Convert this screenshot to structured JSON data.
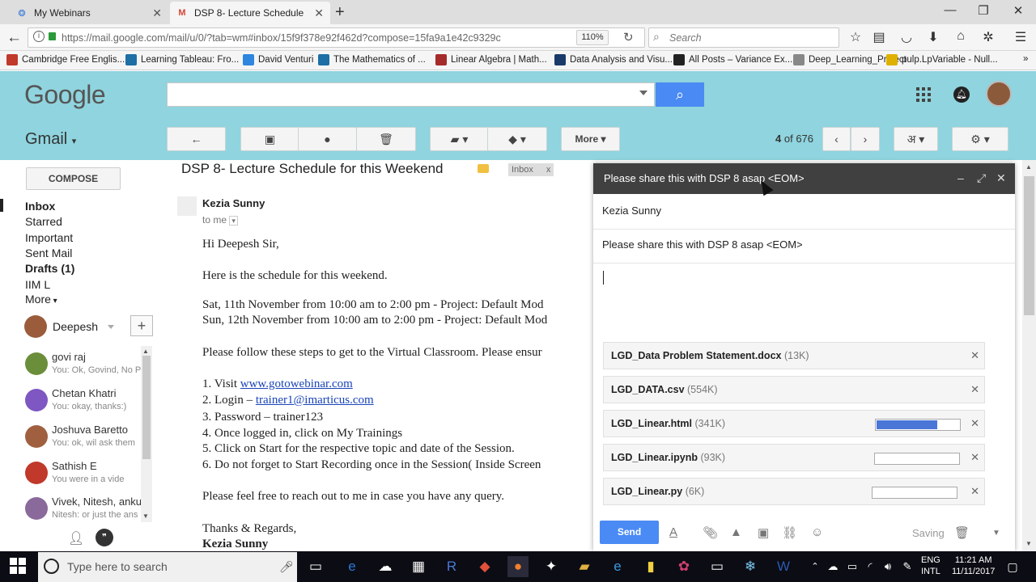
{
  "browser": {
    "tabs": [
      {
        "title": "My Webinars"
      },
      {
        "title": "DSP 8- Lecture Schedule for"
      }
    ],
    "url": "https://mail.google.com/mail/u/0/?tab=wm#inbox/15f9f378e92f462d?compose=15fa9a1e42c9329c",
    "zoom": "110%",
    "search_placeholder": "Search",
    "bookmarks": [
      {
        "label": "Cambridge Free Englis...",
        "color": "#c0392b"
      },
      {
        "label": "Learning Tableau: Fro...",
        "color": "#1d6fa5"
      },
      {
        "label": "David Venturi",
        "color": "#2e86de"
      },
      {
        "label": "The Mathematics of ...",
        "color": "#1d6fa5"
      },
      {
        "label": "Linear Algebra | Math...",
        "color": "#a52a2a"
      },
      {
        "label": "Data Analysis and Visu...",
        "color": "#1a3a6a"
      },
      {
        "label": "All Posts – Variance Ex...",
        "color": "#222222"
      },
      {
        "label": "Deep_Learning_Project",
        "color": "#888888"
      },
      {
        "label": "pulp.LpVariable - Null...",
        "color": "#e0b000"
      }
    ]
  },
  "gmail": {
    "logo": "Google",
    "product": "Gmail",
    "compose_label": "COMPOSE",
    "nav": [
      "Inbox",
      "Starred",
      "Important",
      "Sent Mail",
      "Drafts (1)",
      "IIM L",
      "More"
    ],
    "user": "Deepesh",
    "chats": [
      {
        "name": "govi raj",
        "snippet": "You: Ok, Govind, No P",
        "color": "#6b8e3a"
      },
      {
        "name": "Chetan Khatri",
        "snippet": "You: okay, thanks:)",
        "color": "#7e57c2"
      },
      {
        "name": "Joshuva Baretto",
        "snippet": "You: ok, wil ask them",
        "color": "#a06040"
      },
      {
        "name": "Sathish E",
        "snippet": "You were in a vide",
        "color": "#c0392b"
      },
      {
        "name": "Vivek, Nitesh, anku",
        "snippet": "Nitesh: or just the ans",
        "color": "#8a6a9a"
      }
    ],
    "toolbar": {
      "more": "More",
      "page_info_a": "4",
      "page_info_b": "of 676",
      "lang": "अ"
    }
  },
  "message": {
    "subject": "DSP 8- Lecture Schedule for this Weekend",
    "tag": "Inbox",
    "sender": "Kezia Sunny",
    "to": "to me",
    "lines": [
      "Hi Deepesh Sir,",
      "Here is the schedule for this weekend.",
      "Sat,  11th November from 10:00 am to 2:00 pm  - Project: Default Mod",
      "Sun, 12th November from 10:00 am to 2:00 pm -  Project: Default Mod",
      "Please follow these steps to get to the Virtual Classroom. Please ensur",
      "1.  Visit ",
      "www.gotowebinar.com",
      "2.  Login – ",
      "trainer1@imarticus.com",
      "3.  Password – trainer123",
      "4.  Once logged in, click on My Trainings",
      "5.  Click on Start for the respective topic and date of the Session.",
      "6.  Do not forget to Start Recording once in the Session( Inside Screen",
      "Please feel free to reach out to me in case you have any query.",
      "Thanks & Regards,",
      "Kezia Sunny"
    ]
  },
  "compose": {
    "title": "Please share this with DSP 8 asap <EOM>",
    "to": "Kezia Sunny",
    "subject": "Please share this with DSP 8 asap <EOM>",
    "attachments": [
      {
        "name": "LGD_Data Problem Statement.docx",
        "size": "(13K)",
        "progress": null
      },
      {
        "name": "LGD_DATA.csv",
        "size": "(554K)",
        "progress": null
      },
      {
        "name": "LGD_Linear.html",
        "size": "(341K)",
        "progress": 0.74
      },
      {
        "name": "LGD_Linear.ipynb",
        "size": "(93K)",
        "progress": 0
      },
      {
        "name": "LGD_Linear.py",
        "size": "(6K)",
        "progress": 0
      }
    ],
    "send_label": "Send",
    "status": "Saving"
  },
  "taskbar": {
    "search_placeholder": "Type here to search",
    "lang1": "ENG",
    "lang2": "INTL",
    "time": "11:21 AM",
    "date": "11/11/2017"
  }
}
